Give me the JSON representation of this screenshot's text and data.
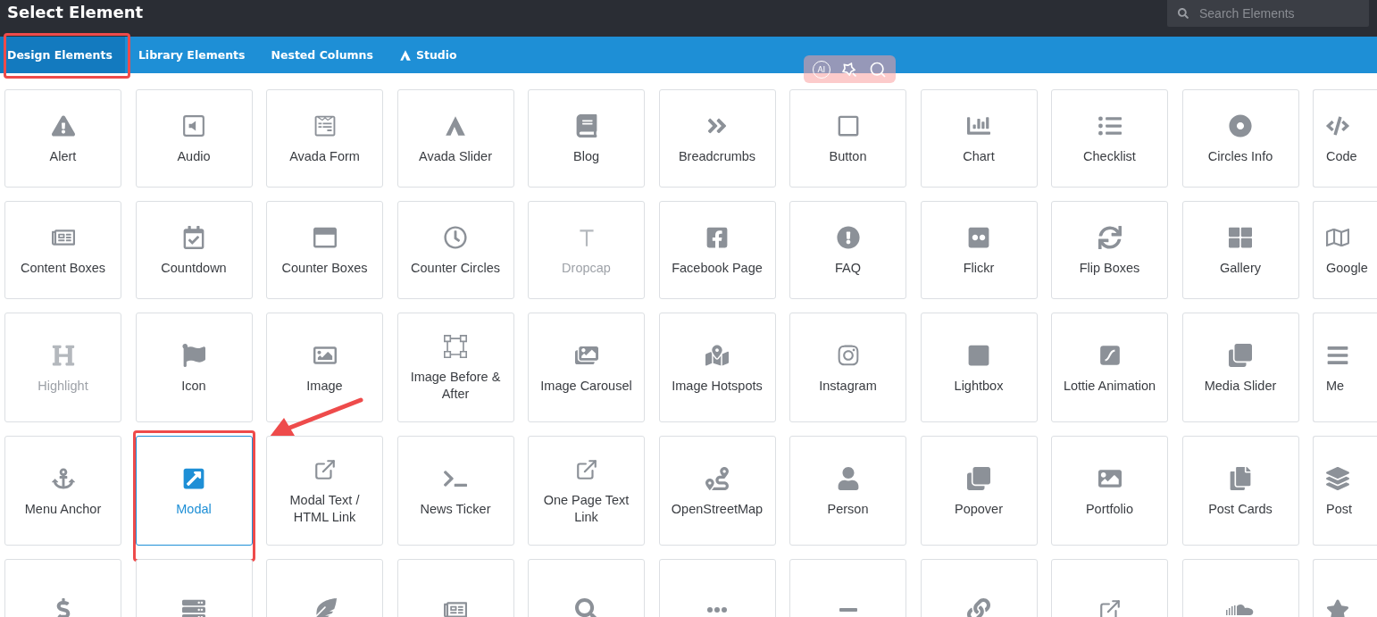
{
  "window": {
    "title": "Select Element"
  },
  "search": {
    "placeholder": "Search Elements"
  },
  "tabs": [
    {
      "label": "Design Elements",
      "selected": true,
      "highlighted": true
    },
    {
      "label": "Library Elements",
      "selected": false,
      "highlighted": false
    },
    {
      "label": "Nested Columns",
      "selected": false,
      "highlighted": false
    },
    {
      "label": "Studio",
      "selected": false,
      "highlighted": false
    }
  ],
  "floating_toolbar": {
    "ai_label": "AI"
  },
  "elements": [
    {
      "label": "Alert",
      "disabled": false,
      "selected": false,
      "highlighted": false
    },
    {
      "label": "Audio",
      "disabled": false,
      "selected": false,
      "highlighted": false
    },
    {
      "label": "Avada Form",
      "disabled": false,
      "selected": false,
      "highlighted": false
    },
    {
      "label": "Avada Slider",
      "disabled": false,
      "selected": false,
      "highlighted": false
    },
    {
      "label": "Blog",
      "disabled": false,
      "selected": false,
      "highlighted": false
    },
    {
      "label": "Breadcrumbs",
      "disabled": false,
      "selected": false,
      "highlighted": false
    },
    {
      "label": "Button",
      "disabled": false,
      "selected": false,
      "highlighted": false
    },
    {
      "label": "Chart",
      "disabled": false,
      "selected": false,
      "highlighted": false
    },
    {
      "label": "Checklist",
      "disabled": false,
      "selected": false,
      "highlighted": false
    },
    {
      "label": "Circles Info",
      "disabled": false,
      "selected": false,
      "highlighted": false
    },
    {
      "label": "Code",
      "disabled": false,
      "selected": false,
      "highlighted": false
    },
    {
      "label": "Content Boxes",
      "disabled": false,
      "selected": false,
      "highlighted": false
    },
    {
      "label": "Countdown",
      "disabled": false,
      "selected": false,
      "highlighted": false
    },
    {
      "label": "Counter Boxes",
      "disabled": false,
      "selected": false,
      "highlighted": false
    },
    {
      "label": "Counter Circles",
      "disabled": false,
      "selected": false,
      "highlighted": false
    },
    {
      "label": "Dropcap",
      "disabled": true,
      "selected": false,
      "highlighted": false
    },
    {
      "label": "Facebook Page",
      "disabled": false,
      "selected": false,
      "highlighted": false
    },
    {
      "label": "FAQ",
      "disabled": false,
      "selected": false,
      "highlighted": false
    },
    {
      "label": "Flickr",
      "disabled": false,
      "selected": false,
      "highlighted": false
    },
    {
      "label": "Flip Boxes",
      "disabled": false,
      "selected": false,
      "highlighted": false
    },
    {
      "label": "Gallery",
      "disabled": false,
      "selected": false,
      "highlighted": false
    },
    {
      "label": "Google",
      "disabled": false,
      "selected": false,
      "highlighted": false
    },
    {
      "label": "Highlight",
      "disabled": true,
      "selected": false,
      "highlighted": false
    },
    {
      "label": "Icon",
      "disabled": false,
      "selected": false,
      "highlighted": false
    },
    {
      "label": "Image",
      "disabled": false,
      "selected": false,
      "highlighted": false
    },
    {
      "label": "Image Before & After",
      "disabled": false,
      "selected": false,
      "highlighted": false
    },
    {
      "label": "Image Carousel",
      "disabled": false,
      "selected": false,
      "highlighted": false
    },
    {
      "label": "Image Hotspots",
      "disabled": false,
      "selected": false,
      "highlighted": false
    },
    {
      "label": "Instagram",
      "disabled": false,
      "selected": false,
      "highlighted": false
    },
    {
      "label": "Lightbox",
      "disabled": false,
      "selected": false,
      "highlighted": false
    },
    {
      "label": "Lottie Animation",
      "disabled": false,
      "selected": false,
      "highlighted": false
    },
    {
      "label": "Media Slider",
      "disabled": false,
      "selected": false,
      "highlighted": false
    },
    {
      "label": "Me",
      "disabled": false,
      "selected": false,
      "highlighted": false
    },
    {
      "label": "Menu Anchor",
      "disabled": false,
      "selected": false,
      "highlighted": false
    },
    {
      "label": "Modal",
      "disabled": false,
      "selected": true,
      "highlighted": true
    },
    {
      "label": "Modal Text / HTML Link",
      "disabled": false,
      "selected": false,
      "highlighted": false
    },
    {
      "label": "News Ticker",
      "disabled": false,
      "selected": false,
      "highlighted": false
    },
    {
      "label": "One Page Text Link",
      "disabled": false,
      "selected": false,
      "highlighted": false
    },
    {
      "label": "OpenStreetMap",
      "disabled": false,
      "selected": false,
      "highlighted": false
    },
    {
      "label": "Person",
      "disabled": false,
      "selected": false,
      "highlighted": false
    },
    {
      "label": "Popover",
      "disabled": false,
      "selected": false,
      "highlighted": false
    },
    {
      "label": "Portfolio",
      "disabled": false,
      "selected": false,
      "highlighted": false
    },
    {
      "label": "Post Cards",
      "disabled": false,
      "selected": false,
      "highlighted": false
    },
    {
      "label": "Post",
      "disabled": false,
      "selected": false,
      "highlighted": false
    },
    {
      "disabled": false,
      "selected": false,
      "highlighted": false
    },
    {
      "disabled": false,
      "selected": false,
      "highlighted": false
    },
    {
      "disabled": false,
      "selected": false,
      "highlighted": false
    },
    {
      "disabled": false,
      "selected": false,
      "highlighted": false
    },
    {
      "disabled": false,
      "selected": false,
      "highlighted": false
    },
    {
      "disabled": false,
      "selected": false,
      "highlighted": false
    },
    {
      "disabled": false,
      "selected": false,
      "highlighted": false
    },
    {
      "disabled": false,
      "selected": false,
      "highlighted": false
    },
    {
      "disabled": false,
      "selected": false,
      "highlighted": false
    },
    {
      "disabled": false,
      "selected": false,
      "highlighted": false
    },
    {
      "disabled": false,
      "selected": false,
      "highlighted": false
    }
  ]
}
